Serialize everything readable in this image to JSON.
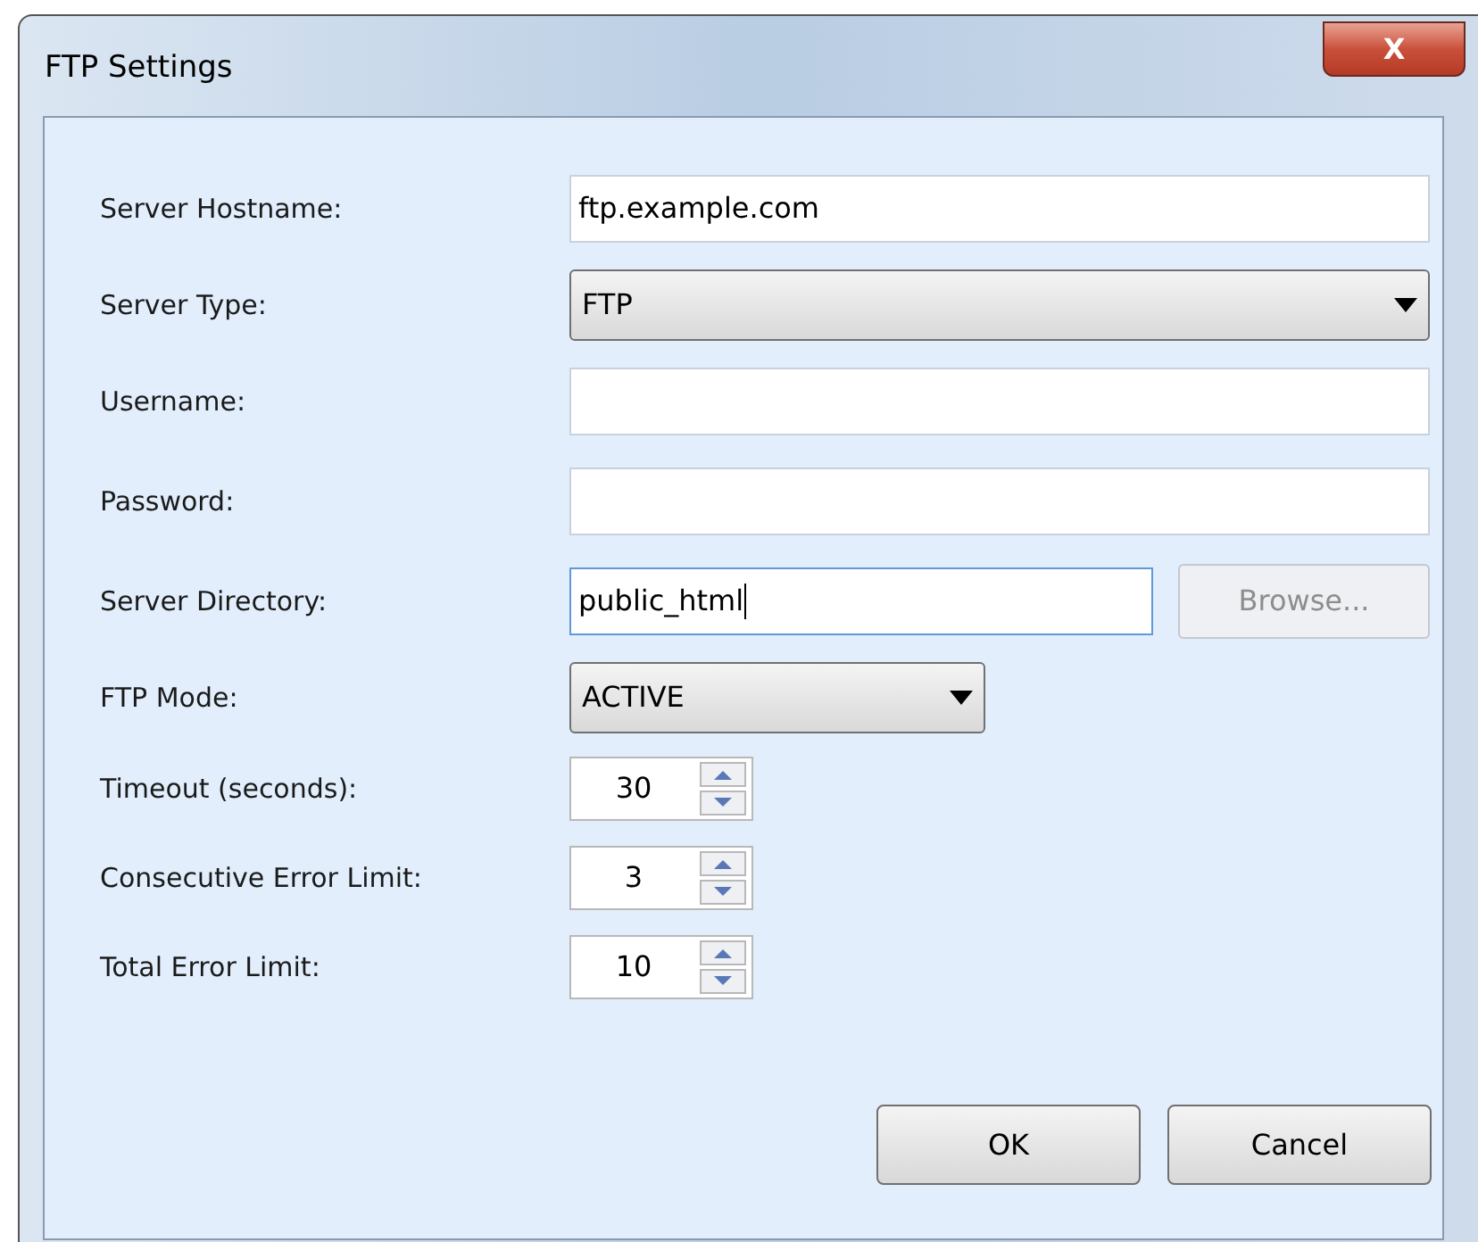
{
  "window": {
    "title": "FTP Settings",
    "close_label": "X"
  },
  "rows": [
    {
      "label": "Server Hostname:",
      "kind": "text",
      "value": "ftp.example.com",
      "focused": false
    },
    {
      "label": "Server Type:",
      "kind": "select",
      "value": "FTP"
    },
    {
      "label": "Username:",
      "kind": "text",
      "focused": false
    },
    {
      "label": "Password:",
      "kind": "text",
      "focused": false
    },
    {
      "label": "Server Directory:",
      "kind": "text",
      "value": "public_html",
      "focused": true,
      "button": {
        "label": "Browse...",
        "disabled": true
      }
    },
    {
      "label": "FTP Mode:",
      "kind": "combo",
      "value": "ACTIVE"
    },
    {
      "label": "Timeout (seconds):",
      "kind": "spinner",
      "value": "30"
    },
    {
      "label": "Consecutive Error Limit:",
      "kind": "spinner",
      "value": "3"
    },
    {
      "label": "Total Error Limit:",
      "kind": "spinner",
      "value": "10"
    }
  ],
  "buttons": [
    "OK",
    "Cancel"
  ]
}
